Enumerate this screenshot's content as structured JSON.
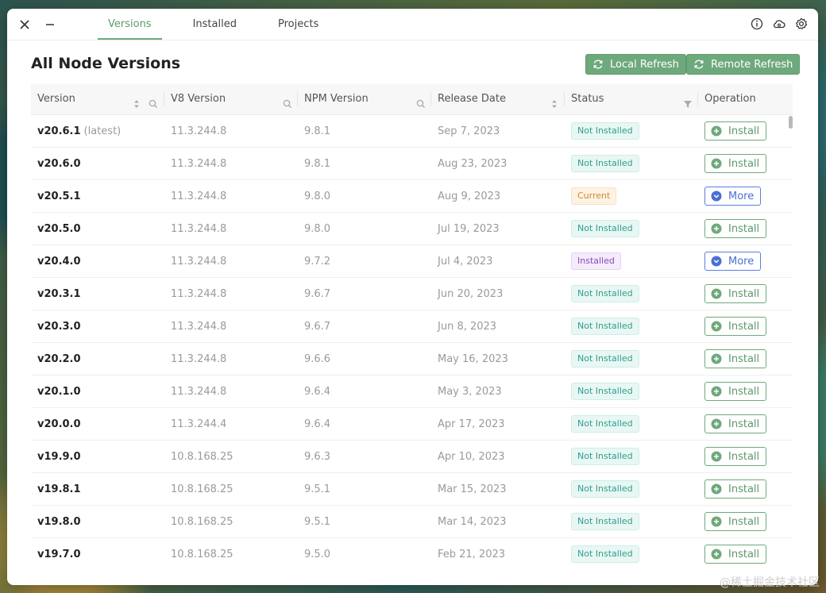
{
  "titlebar": {
    "tabs": [
      {
        "label": "Versions",
        "active": true
      },
      {
        "label": "Installed",
        "active": false
      },
      {
        "label": "Projects",
        "active": false
      }
    ]
  },
  "header": {
    "title": "All Node Versions",
    "local_refresh": "Local Refresh",
    "remote_refresh": "Remote Refresh"
  },
  "table": {
    "columns": [
      "Version",
      "V8 Version",
      "NPM Version",
      "Release Date",
      "Status",
      "Operation"
    ],
    "latest_tag": "(latest)",
    "rows": [
      {
        "version": "v20.6.1",
        "v8": "11.3.244.8",
        "npm": "9.8.1",
        "date": "Sep 7, 2023",
        "status": "Not Installed",
        "status_kind": "not-installed",
        "op": "Install",
        "op_kind": "install",
        "latest": true
      },
      {
        "version": "v20.6.0",
        "v8": "11.3.244.8",
        "npm": "9.8.1",
        "date": "Aug 23, 2023",
        "status": "Not Installed",
        "status_kind": "not-installed",
        "op": "Install",
        "op_kind": "install",
        "latest": false
      },
      {
        "version": "v20.5.1",
        "v8": "11.3.244.8",
        "npm": "9.8.0",
        "date": "Aug 9, 2023",
        "status": "Current",
        "status_kind": "current",
        "op": "More",
        "op_kind": "more",
        "latest": false
      },
      {
        "version": "v20.5.0",
        "v8": "11.3.244.8",
        "npm": "9.8.0",
        "date": "Jul 19, 2023",
        "status": "Not Installed",
        "status_kind": "not-installed",
        "op": "Install",
        "op_kind": "install",
        "latest": false
      },
      {
        "version": "v20.4.0",
        "v8": "11.3.244.8",
        "npm": "9.7.2",
        "date": "Jul 4, 2023",
        "status": "Installed",
        "status_kind": "installed",
        "op": "More",
        "op_kind": "more",
        "latest": false
      },
      {
        "version": "v20.3.1",
        "v8": "11.3.244.8",
        "npm": "9.6.7",
        "date": "Jun 20, 2023",
        "status": "Not Installed",
        "status_kind": "not-installed",
        "op": "Install",
        "op_kind": "install",
        "latest": false
      },
      {
        "version": "v20.3.0",
        "v8": "11.3.244.8",
        "npm": "9.6.7",
        "date": "Jun 8, 2023",
        "status": "Not Installed",
        "status_kind": "not-installed",
        "op": "Install",
        "op_kind": "install",
        "latest": false
      },
      {
        "version": "v20.2.0",
        "v8": "11.3.244.8",
        "npm": "9.6.6",
        "date": "May 16, 2023",
        "status": "Not Installed",
        "status_kind": "not-installed",
        "op": "Install",
        "op_kind": "install",
        "latest": false
      },
      {
        "version": "v20.1.0",
        "v8": "11.3.244.8",
        "npm": "9.6.4",
        "date": "May 3, 2023",
        "status": "Not Installed",
        "status_kind": "not-installed",
        "op": "Install",
        "op_kind": "install",
        "latest": false
      },
      {
        "version": "v20.0.0",
        "v8": "11.3.244.4",
        "npm": "9.6.4",
        "date": "Apr 17, 2023",
        "status": "Not Installed",
        "status_kind": "not-installed",
        "op": "Install",
        "op_kind": "install",
        "latest": false
      },
      {
        "version": "v19.9.0",
        "v8": "10.8.168.25",
        "npm": "9.6.3",
        "date": "Apr 10, 2023",
        "status": "Not Installed",
        "status_kind": "not-installed",
        "op": "Install",
        "op_kind": "install",
        "latest": false
      },
      {
        "version": "v19.8.1",
        "v8": "10.8.168.25",
        "npm": "9.5.1",
        "date": "Mar 15, 2023",
        "status": "Not Installed",
        "status_kind": "not-installed",
        "op": "Install",
        "op_kind": "install",
        "latest": false
      },
      {
        "version": "v19.8.0",
        "v8": "10.8.168.25",
        "npm": "9.5.1",
        "date": "Mar 14, 2023",
        "status": "Not Installed",
        "status_kind": "not-installed",
        "op": "Install",
        "op_kind": "install",
        "latest": false
      },
      {
        "version": "v19.7.0",
        "v8": "10.8.168.25",
        "npm": "9.5.0",
        "date": "Feb 21, 2023",
        "status": "Not Installed",
        "status_kind": "not-installed",
        "op": "Install",
        "op_kind": "install",
        "latest": false
      }
    ]
  },
  "icons": {
    "close": "close-icon",
    "minimize": "minimize-icon",
    "info": "info-icon",
    "cloud": "cloud-sync-icon",
    "settings": "gear-icon",
    "sort": "sort-icon",
    "search": "search-icon",
    "filter": "filter-icon",
    "refresh": "refresh-icon",
    "plus": "plus-circle-icon",
    "chevron": "chevron-down-circle-icon"
  },
  "colors": {
    "accent_green": "#6ea97c",
    "accent_blue": "#5a7ee0",
    "status_not_installed": "#2f9e8a",
    "status_current": "#d08a2c",
    "status_installed": "#8b49bd"
  },
  "watermark": "@稀土掘金技术社区"
}
